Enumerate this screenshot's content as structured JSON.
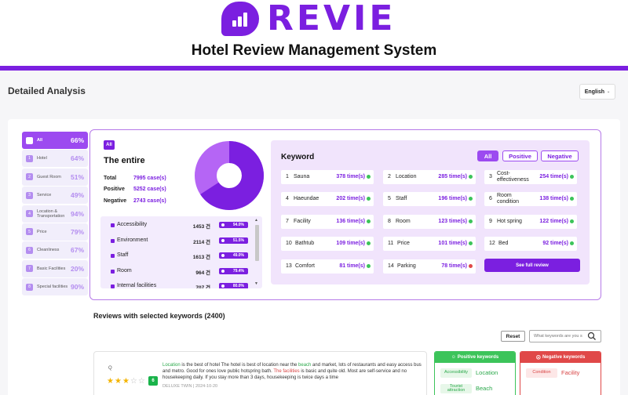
{
  "header": {
    "logo_text": "REVIE",
    "title": "Hotel Review Management System"
  },
  "page": {
    "heading": "Detailed Analysis",
    "language": "English"
  },
  "sidebar": {
    "items": [
      {
        "label": "All",
        "percent": "66%",
        "active": true
      },
      {
        "label": "Hotel",
        "percent": "64%"
      },
      {
        "label": "Guest Room",
        "percent": "51%"
      },
      {
        "label": "Service",
        "percent": "49%"
      },
      {
        "label": "Location & Transportation",
        "percent": "94%"
      },
      {
        "label": "Price",
        "percent": "79%"
      },
      {
        "label": "Cleanliness",
        "percent": "67%"
      },
      {
        "label": "Basic Facilities",
        "percent": "20%"
      },
      {
        "label": "Special facilities",
        "percent": "90%"
      }
    ]
  },
  "summary": {
    "badge": "All",
    "title": "The entire",
    "total_label": "Total",
    "total_value": "7995 case(s)",
    "positive_label": "Positive",
    "positive_value": "5252 case(s)",
    "negative_label": "Negative",
    "negative_value": "2743 case(s)",
    "positive_share": 0.657,
    "colors": {
      "positive": "#7b1fe0",
      "negative": "#b565f5"
    }
  },
  "categories": [
    {
      "name": "Accessibility",
      "count": "1453 건",
      "percent": "94.0%"
    },
    {
      "name": "Environment",
      "count": "2114 건",
      "percent": "51.5%"
    },
    {
      "name": "Staff",
      "count": "1613 건",
      "percent": "49.0%"
    },
    {
      "name": "Room",
      "count": "964 건",
      "percent": "79.4%"
    },
    {
      "name": "Internal facilities",
      "count": "707 건",
      "percent": "80.0%"
    }
  ],
  "keywords": {
    "title": "Keyword",
    "filters": [
      "All",
      "Positive",
      "Negative"
    ],
    "items": [
      {
        "rank": "1",
        "name": "Sauna",
        "count": "378 time(s)",
        "sentiment": "positive"
      },
      {
        "rank": "2",
        "name": "Location",
        "count": "285 time(s)",
        "sentiment": "positive"
      },
      {
        "rank": "3",
        "name": "Cost-effectiveness",
        "count": "254 time(s)",
        "sentiment": "positive"
      },
      {
        "rank": "4",
        "name": "Haeundae",
        "count": "202 time(s)",
        "sentiment": "positive"
      },
      {
        "rank": "5",
        "name": "Staff",
        "count": "196 time(s)",
        "sentiment": "positive"
      },
      {
        "rank": "6",
        "name": "Room condition",
        "count": "138 time(s)",
        "sentiment": "positive"
      },
      {
        "rank": "7",
        "name": "Facility",
        "count": "136 time(s)",
        "sentiment": "positive"
      },
      {
        "rank": "8",
        "name": "Room",
        "count": "123 time(s)",
        "sentiment": "positive"
      },
      {
        "rank": "9",
        "name": "Hot spring",
        "count": "122 time(s)",
        "sentiment": "positive"
      },
      {
        "rank": "10",
        "name": "Bathtub",
        "count": "109 time(s)",
        "sentiment": "positive"
      },
      {
        "rank": "11",
        "name": "Price",
        "count": "101 time(s)",
        "sentiment": "positive"
      },
      {
        "rank": "12",
        "name": "Bed",
        "count": "92 time(s)",
        "sentiment": "positive"
      },
      {
        "rank": "13",
        "name": "Comfort",
        "count": "81 time(s)",
        "sentiment": "positive"
      },
      {
        "rank": "14",
        "name": "Parking",
        "count": "78 time(s)",
        "sentiment": "negative"
      }
    ],
    "full_review_label": "See full review"
  },
  "reviews": {
    "heading": "Reviews with selected keywords (2400)",
    "reset_label": "Reset",
    "search_placeholder": "What keywords are you s",
    "item": {
      "avatar": "Q",
      "rating": 3,
      "score": "6",
      "text_parts": [
        {
          "t": "Location",
          "c": "g"
        },
        {
          "t": " is the best of hotel The hotel is best of location near the "
        },
        {
          "t": "beach",
          "c": "g"
        },
        {
          "t": " and market, lots of restaurants and easy access bus and metro. Good for ones love public hotspring bath. "
        },
        {
          "t": "The facilities",
          "c": "r"
        },
        {
          "t": " is basic and quite old. Most are self-service and no housekeeping daily. If you stay more than 3 days, housekeeping is twice days a time"
        }
      ],
      "meta": "DELUXE TWIN | 2024-10-20"
    },
    "positive_keywords": {
      "title": "Positive keywords",
      "items": [
        {
          "tag": "Accessibility",
          "value": "Location"
        },
        {
          "tag": "Tourist attraction",
          "value": "Beach"
        }
      ]
    },
    "negative_keywords": {
      "title": "Negative keywords",
      "items": [
        {
          "tag": "Condition",
          "value": "Facility"
        }
      ]
    }
  }
}
